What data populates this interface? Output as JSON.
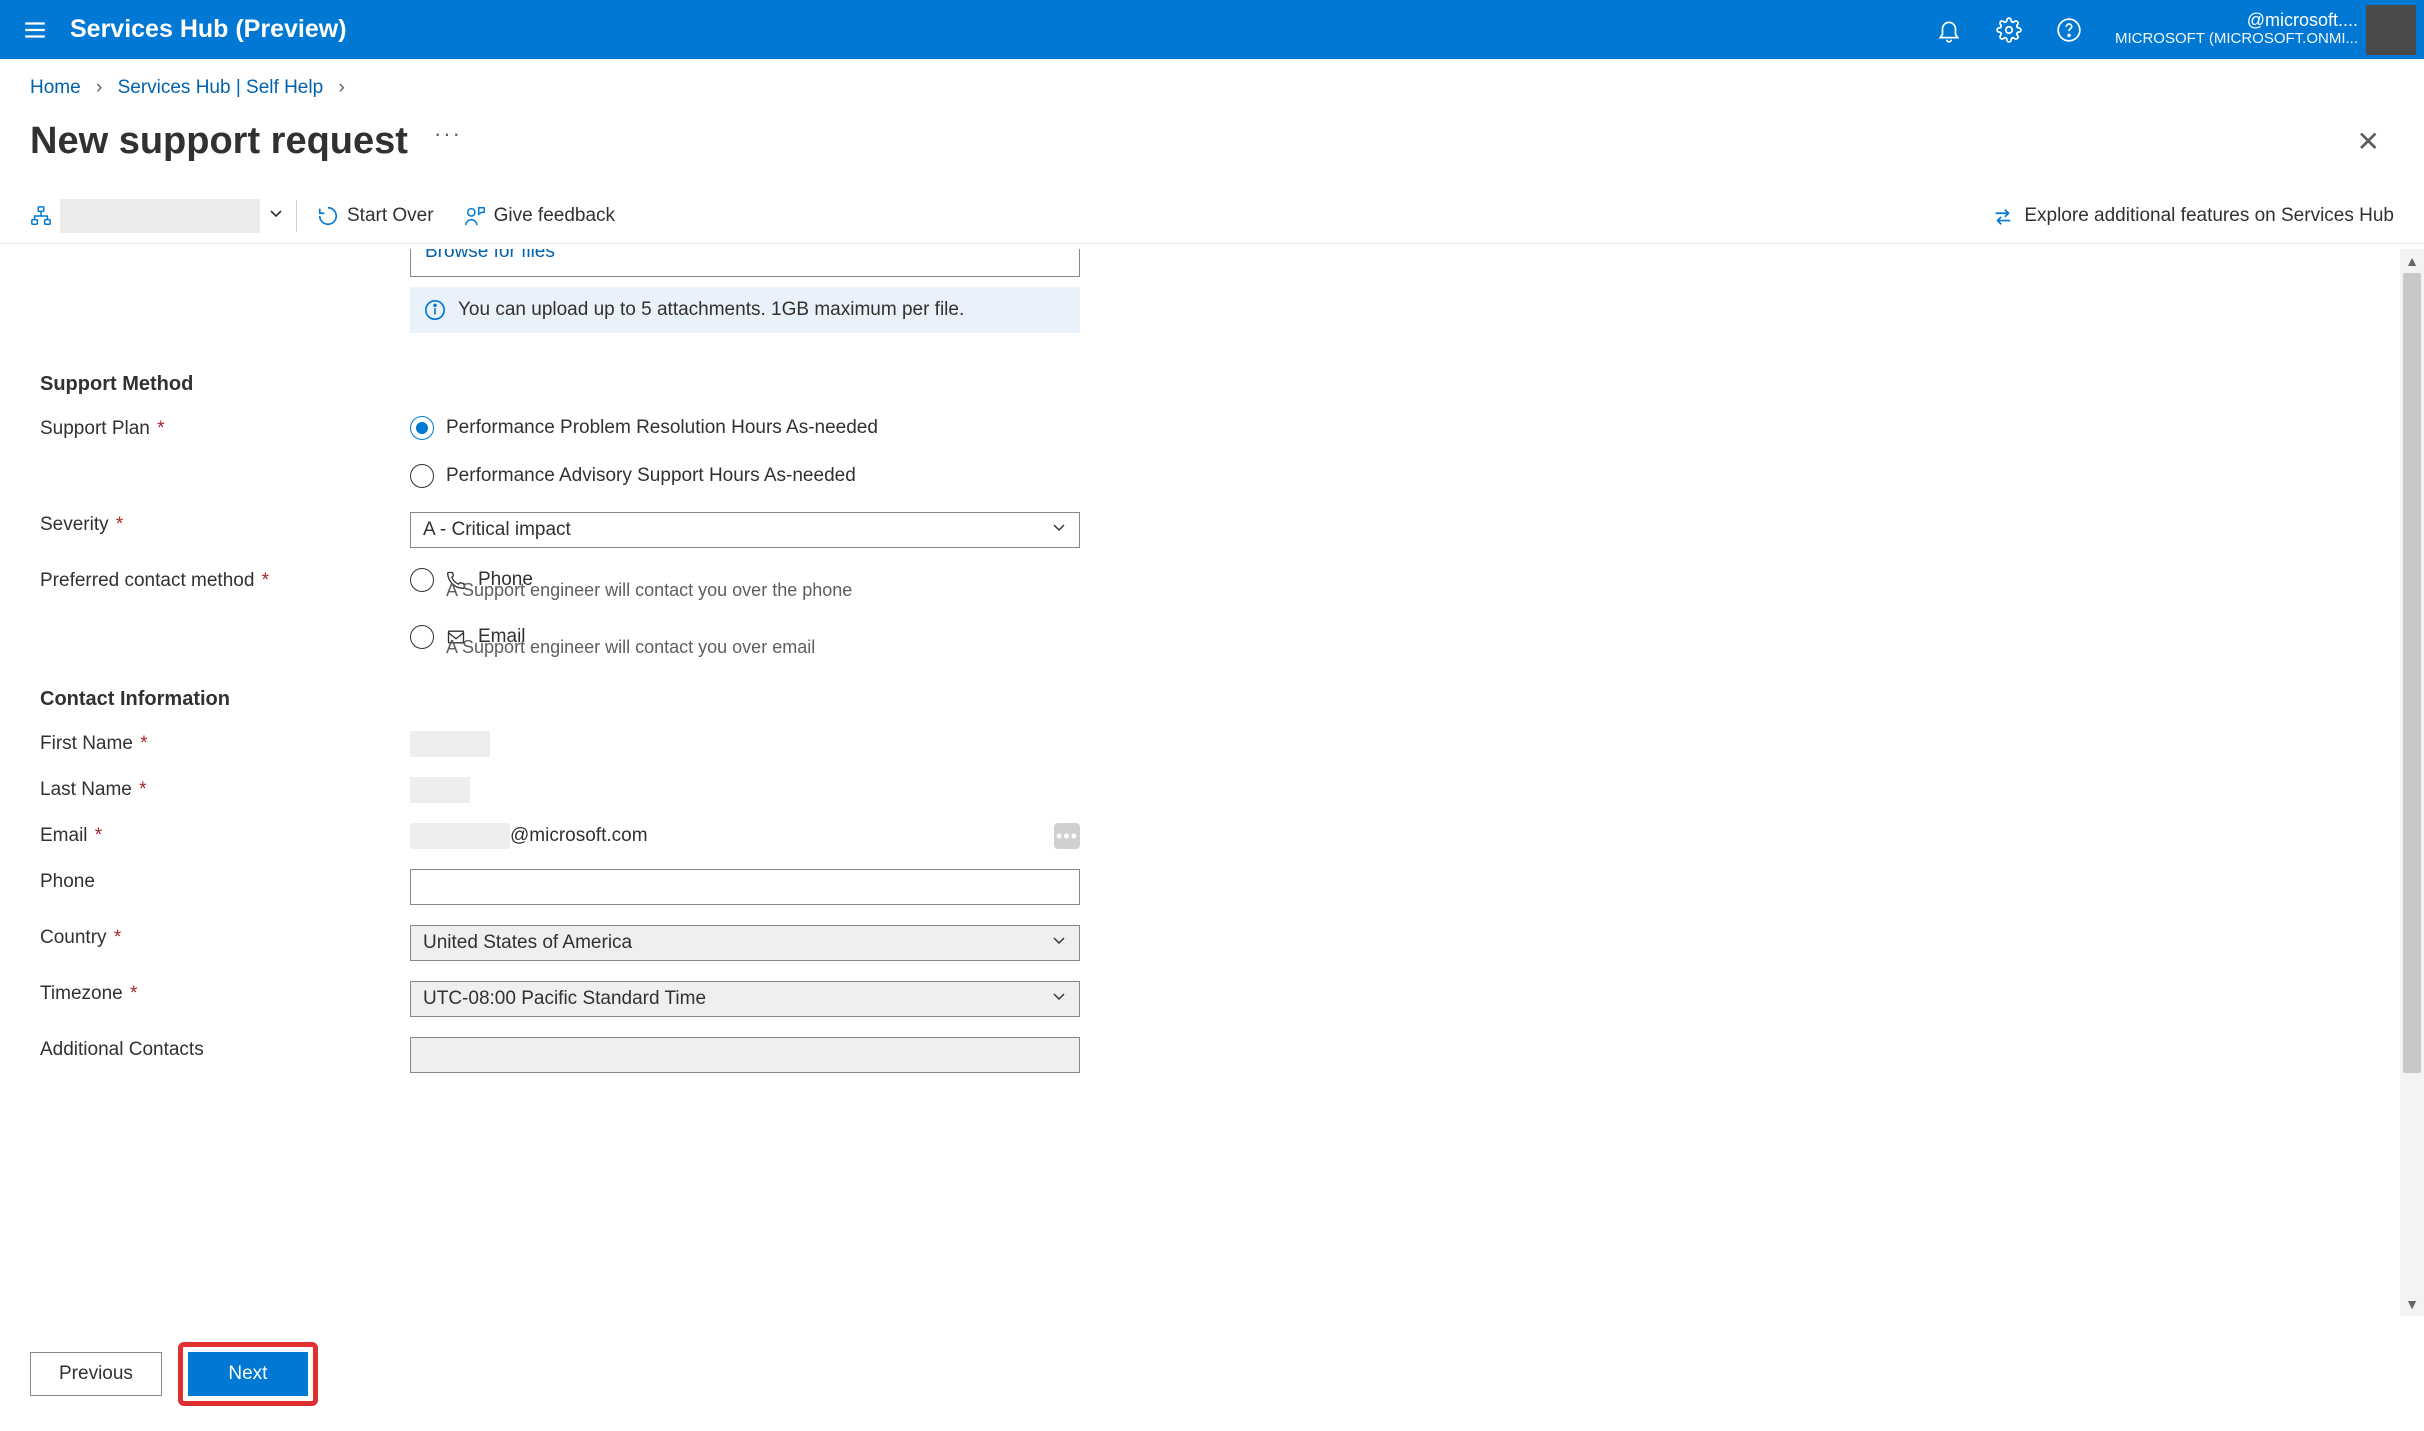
{
  "header": {
    "brand": "Services Hub (Preview)",
    "account_line1": "@microsoft....",
    "account_line2": "MICROSOFT (MICROSOFT.ONMI..."
  },
  "breadcrumb": {
    "home": "Home",
    "self_help": "Services Hub | Self Help"
  },
  "title": "New support request",
  "toolbar": {
    "start_over": "Start Over",
    "give_feedback": "Give feedback",
    "explore": "Explore additional features on Services Hub"
  },
  "upload": {
    "browse": "Browse for files",
    "info": "You can upload up to 5 attachments. 1GB maximum per file."
  },
  "sections": {
    "support_method": "Support Method",
    "contact_info": "Contact Information"
  },
  "support_method": {
    "support_plan_label": "Support Plan",
    "plan_option_1": "Performance Problem Resolution Hours As-needed",
    "plan_option_2": "Performance Advisory Support Hours As-needed",
    "severity_label": "Severity",
    "severity_value": "A - Critical impact",
    "contact_method_label": "Preferred contact method",
    "phone_label": "Phone",
    "phone_sub": "A Support engineer will contact you over the phone",
    "email_label": "Email",
    "email_sub": "A Support engineer will contact you over email"
  },
  "contact": {
    "first_name_label": "First Name",
    "last_name_label": "Last Name",
    "email_label": "Email",
    "email_suffix": "@microsoft.com",
    "phone_label": "Phone",
    "country_label": "Country",
    "country_value": "United States of America",
    "timezone_label": "Timezone",
    "timezone_value": "UTC-08:00 Pacific Standard Time",
    "additional_label": "Additional Contacts"
  },
  "buttons": {
    "previous": "Previous",
    "next": "Next"
  }
}
